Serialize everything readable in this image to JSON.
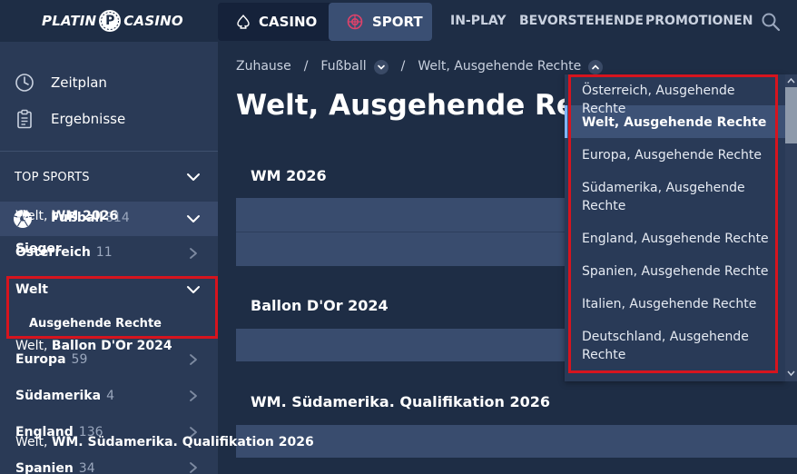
{
  "header": {
    "logo_left": "PLATIN",
    "logo_badge": "P",
    "logo_right": "CASINO",
    "nav": {
      "casino": "CASINO",
      "sport": "SPORT",
      "in_play": "IN-PLAY",
      "upcoming": "BEVORSTEHENDE",
      "promotions": "PROMOTIONEN"
    },
    "icons": {
      "search": "search-icon",
      "casino": "spade-icon",
      "sport": "target-icon"
    }
  },
  "sidebar": {
    "schedule": "Zeitplan",
    "results": "Ergebnisse",
    "top_sports": "TOP SPORTS",
    "football": {
      "label": "Fußball",
      "count": "814"
    },
    "categories": [
      {
        "label": "Österreich",
        "count": "11"
      },
      {
        "label": "Welt",
        "count": ""
      },
      {
        "label": "Europa",
        "count": "59"
      },
      {
        "label": "Südamerika",
        "count": "4"
      },
      {
        "label": "England",
        "count": "136"
      },
      {
        "label": "Spanien",
        "count": "34"
      }
    ],
    "welt_subitem": "Ausgehende Rechte"
  },
  "breadcrumb": {
    "home": "Zuhause",
    "sport": "Fußball",
    "current": "Welt, Ausgehende Rechte"
  },
  "main": {
    "title": "Welt, Ausgehende Rechte",
    "sections": [
      {
        "title": "WM 2026",
        "row_prefix": "Welt,",
        "row_bold": "WM 2026",
        "row2": "Sieger"
      },
      {
        "title": "Ballon D'Or 2024",
        "row_prefix": "Welt,",
        "row_bold": "Ballon D'Or 2024"
      },
      {
        "title": "WM. Südamerika. Qualifikation 2026",
        "row_prefix": "Welt,",
        "row_bold": "WM. Südamerika. Qualifikation 2026"
      }
    ]
  },
  "dropdown": {
    "items": [
      "Österreich, Ausgehende Rechte",
      "Welt, Ausgehende Rechte",
      "Europa, Ausgehende Rechte",
      "Südamerika, Ausgehende Rechte",
      "England, Ausgehende Rechte",
      "Spanien, Ausgehende Rechte",
      "Italien, Ausgehende Rechte",
      "Deutschland, Ausgehende Rechte"
    ],
    "selected": "Welt, Ausgehende Rechte"
  },
  "colors": {
    "background": "#1e2d45",
    "sidebar": "#2a3a56",
    "active_row": "#38496a",
    "card": "#394c6e",
    "sport_tab": "#3a4f73",
    "highlight_border": "#d6141e",
    "sport_icon": "#e0426a"
  }
}
